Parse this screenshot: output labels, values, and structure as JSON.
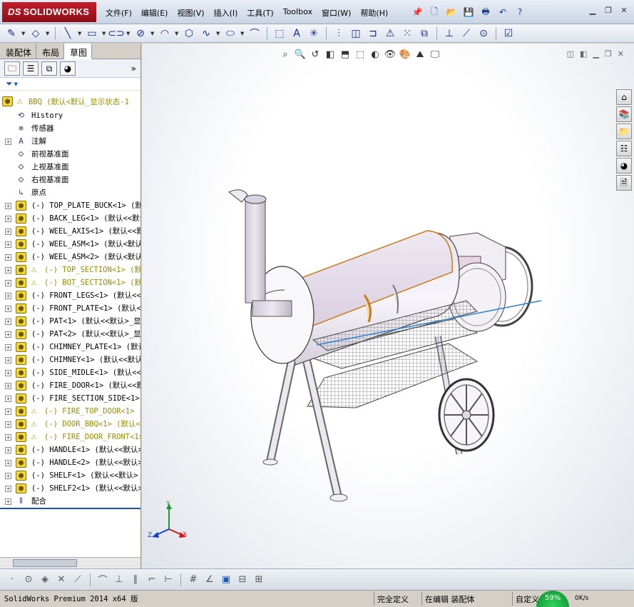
{
  "app": {
    "brand": "SOLIDWORKS",
    "menus": [
      "文件(F)",
      "编辑(E)",
      "视图(V)",
      "插入(I)",
      "工具(T)",
      "Toolbox",
      "窗口(W)",
      "帮助(H)"
    ]
  },
  "tabs": [
    "装配体",
    "布局",
    "草图"
  ],
  "active_tab": "草图",
  "tree": {
    "root": "BBQ  (默认<默认_显示状态-1",
    "items": [
      {
        "label": "History",
        "kind": "history"
      },
      {
        "label": "传感器",
        "kind": "sensor"
      },
      {
        "label": "注解",
        "kind": "annotation"
      },
      {
        "label": "前视基准面",
        "kind": "plane"
      },
      {
        "label": "上视基准面",
        "kind": "plane"
      },
      {
        "label": "右视基准面",
        "kind": "plane"
      },
      {
        "label": "原点",
        "kind": "origin"
      },
      {
        "label": "(-) TOP_PLATE_BUCK<1> (默认",
        "kind": "part"
      },
      {
        "label": "(-) BACK_LEG<1> (默认<<默认",
        "kind": "part"
      },
      {
        "label": "(-) WEEL_AXIS<1> (默认<<默",
        "kind": "part"
      },
      {
        "label": "(-) WEEL_ASM<1> (默认<默认",
        "kind": "asm"
      },
      {
        "label": "(-) WEEL_ASM<2> (默认<默认",
        "kind": "asm"
      },
      {
        "label": "(-) TOP_SECTION<1> (默认",
        "kind": "warn"
      },
      {
        "label": "(-) BOT_SECTION<1> (默认",
        "kind": "warn"
      },
      {
        "label": "(-) FRONT_LEGS<1> (默认<<",
        "kind": "part"
      },
      {
        "label": "(-) FRONT_PLATE<1> (默认<<",
        "kind": "part"
      },
      {
        "label": "(-) PAT<1> (默认<<默认>_显",
        "kind": "part"
      },
      {
        "label": "(-) PAT<2> (默认<<默认>_显",
        "kind": "part"
      },
      {
        "label": "(-) CHIMNEY_PLATE<1> (默认",
        "kind": "part"
      },
      {
        "label": "(-) CHIMNEY<1> (默认<<默认",
        "kind": "part"
      },
      {
        "label": "(-) SIDE_MIDLE<1> (默认<<",
        "kind": "part"
      },
      {
        "label": "(-) FIRE_DOOR<1> (默认<<默",
        "kind": "part"
      },
      {
        "label": "(-) FIRE_SECTION_SIDE<1>",
        "kind": "part"
      },
      {
        "label": "(-) FIRE_TOP_DOOR<1> (默",
        "kind": "warn"
      },
      {
        "label": "(-) DOOR_BBQ<1> (默认<<默",
        "kind": "warn"
      },
      {
        "label": "(-) FIRE_DOOR_FRONT<1>",
        "kind": "warn"
      },
      {
        "label": "(-) HANDLE<1> (默认<<默认>",
        "kind": "part"
      },
      {
        "label": "(-) HANDLE<2> (默认<<默认>",
        "kind": "part"
      },
      {
        "label": "(-) SHELF<1> (默认<<默认>",
        "kind": "part"
      },
      {
        "label": "(-) SHELF2<1> (默认<<默认>",
        "kind": "part"
      },
      {
        "label": "配合",
        "kind": "mate"
      }
    ]
  },
  "triad": {
    "x": "X",
    "y": "Y",
    "z": "Z"
  },
  "status": {
    "app": "SolidWorks Premium 2014 x64 版",
    "state": "完全定义",
    "mode": "在编辑 装配体",
    "custom": "自定义",
    "gauge": "59%",
    "speed": "0K/s"
  }
}
